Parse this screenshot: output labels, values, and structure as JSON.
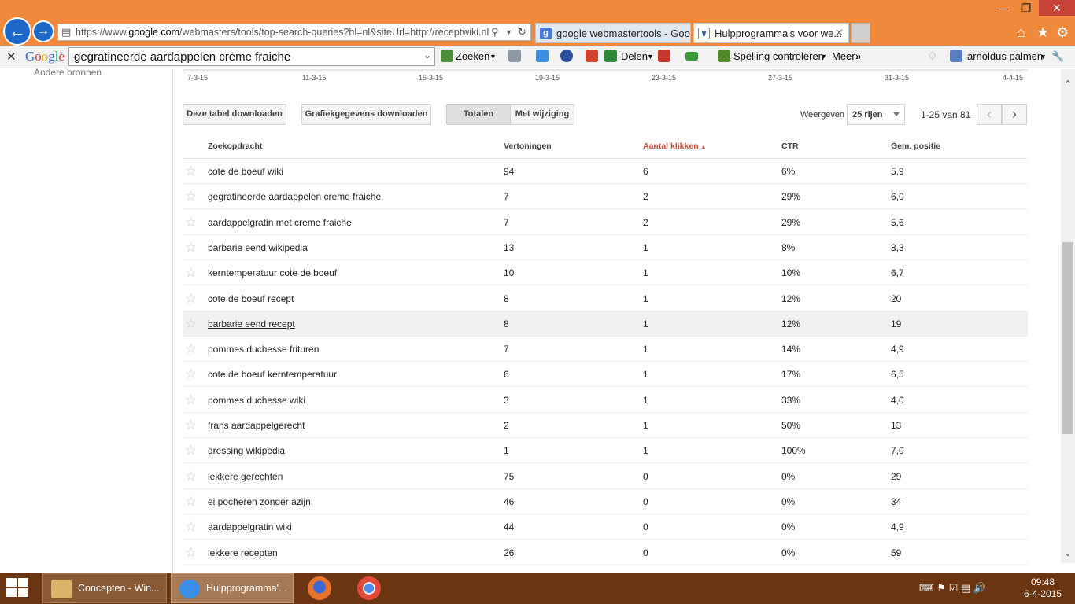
{
  "browser": {
    "url_prefix": "https://www.",
    "url_domain": "google.com",
    "url_rest": "/webmasters/tools/top-search-queries?hl=nl&siteUrl=http://receptwiki.nl",
    "tabs": [
      {
        "title": "google webmastertools - Goo...",
        "active": false
      },
      {
        "title": "Hulpprogramma's voor we...",
        "active": true
      }
    ]
  },
  "google_toolbar": {
    "search_value": "gegratineerde aardappelen creme fraiche",
    "search_label": "Zoeken",
    "share_label": "Delen",
    "spell_label": "Spelling controleren",
    "more_label": "Meer",
    "user_name": "arnoldus palmen"
  },
  "sidebar": {
    "link": "Andere bronnen"
  },
  "chart_axis": [
    "7-3-15",
    "11-3-15",
    "15-3-15",
    "19-3-15",
    "23-3-15",
    "27-3-15",
    "31-3-15",
    "4-4-15"
  ],
  "toolbar": {
    "download_table": "Deze tabel downloaden",
    "download_graph": "Grafiekgegevens downloaden",
    "totals": "Totalen",
    "with_change": "Met wijziging",
    "show_label": "Weergeven",
    "rows_value": "25 rijen",
    "pager": "1-25 van 81"
  },
  "table": {
    "headers": {
      "query": "Zoekopdracht",
      "impressions": "Vertoningen",
      "clicks": "Aantal klikken",
      "ctr": "CTR",
      "position": "Gem. positie"
    },
    "rows": [
      {
        "query": "cote de boeuf wiki",
        "impressions": "94",
        "clicks": "6",
        "ctr": "6%",
        "position": "5,9"
      },
      {
        "query": "gegratineerde aardappelen creme fraiche",
        "impressions": "7",
        "clicks": "2",
        "ctr": "29%",
        "position": "6,0"
      },
      {
        "query": "aardappelgratin met creme fraiche",
        "impressions": "7",
        "clicks": "2",
        "ctr": "29%",
        "position": "5,6"
      },
      {
        "query": "barbarie eend wikipedia",
        "impressions": "13",
        "clicks": "1",
        "ctr": "8%",
        "position": "8,3"
      },
      {
        "query": "kerntemperatuur cote de boeuf",
        "impressions": "10",
        "clicks": "1",
        "ctr": "10%",
        "position": "6,7"
      },
      {
        "query": "cote de boeuf recept",
        "impressions": "8",
        "clicks": "1",
        "ctr": "12%",
        "position": "20"
      },
      {
        "query": "barbarie eend recept",
        "impressions": "8",
        "clicks": "1",
        "ctr": "12%",
        "position": "19"
      },
      {
        "query": "pommes duchesse frituren",
        "impressions": "7",
        "clicks": "1",
        "ctr": "14%",
        "position": "4,9"
      },
      {
        "query": "cote de boeuf kerntemperatuur",
        "impressions": "6",
        "clicks": "1",
        "ctr": "17%",
        "position": "6,5"
      },
      {
        "query": "pommes duchesse wiki",
        "impressions": "3",
        "clicks": "1",
        "ctr": "33%",
        "position": "4,0"
      },
      {
        "query": "frans aardappelgerecht",
        "impressions": "2",
        "clicks": "1",
        "ctr": "50%",
        "position": "13"
      },
      {
        "query": "dressing wikipedia",
        "impressions": "1",
        "clicks": "1",
        "ctr": "100%",
        "position": "7,0"
      },
      {
        "query": "lekkere gerechten",
        "impressions": "75",
        "clicks": "0",
        "ctr": "0%",
        "position": "29"
      },
      {
        "query": "ei pocheren zonder azijn",
        "impressions": "46",
        "clicks": "0",
        "ctr": "0%",
        "position": "34"
      },
      {
        "query": "aardappelgratin wiki",
        "impressions": "44",
        "clicks": "0",
        "ctr": "0%",
        "position": "4,9"
      },
      {
        "query": "lekkere recepten",
        "impressions": "26",
        "clicks": "0",
        "ctr": "0%",
        "position": "59"
      }
    ]
  },
  "taskbar": {
    "tasks": [
      "Concepten - Win...",
      "Hulpprogramma'..."
    ],
    "time": "09:48",
    "date": "6-4-2015"
  }
}
